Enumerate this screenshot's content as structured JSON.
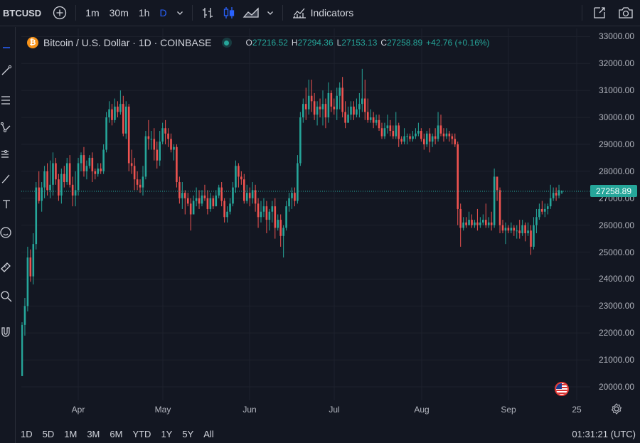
{
  "toolbar": {
    "symbol": "BTCUSD",
    "intervals": [
      "1m",
      "30m",
      "1h",
      "D"
    ],
    "active_interval": "D",
    "indicators_label": "Indicators"
  },
  "legend": {
    "title": "Bitcoin / U.S. Dollar · 1D · COINBASE",
    "open_label": "O",
    "open": "27216.52",
    "high_label": "H",
    "high": "27294.36",
    "low_label": "L",
    "low": "27153.13",
    "close_label": "C",
    "close": "27258.89",
    "change": "+42.76 (+0.16%)"
  },
  "price_axis": {
    "labels": [
      "33000.00",
      "32000.00",
      "31000.00",
      "30000.00",
      "29000.00",
      "28000.00",
      "27000.00",
      "26000.00",
      "25000.00",
      "24000.00",
      "23000.00",
      "22000.00",
      "21000.00",
      "20000.00"
    ],
    "current_price": "27258.89"
  },
  "time_axis": {
    "labels": [
      "Apr",
      "May",
      "Jun",
      "Jul",
      "Aug",
      "Sep",
      "25"
    ]
  },
  "bottom": {
    "ranges": [
      "1D",
      "5D",
      "1M",
      "3M",
      "6M",
      "YTD",
      "1Y",
      "5Y",
      "All"
    ],
    "clock": "01:31:21 (UTC)"
  },
  "colors": {
    "up": "#26a69a",
    "down": "#ef5350",
    "background": "#131722",
    "grid": "#1e222d"
  },
  "chart_data": {
    "type": "candlestick",
    "up_color": "#26a69a",
    "down_color": "#ef5350",
    "ylim": [
      19500,
      33300
    ],
    "candles": [
      [
        20400,
        22300,
        20400,
        22400
      ],
      [
        22300,
        23000,
        21900,
        23300
      ],
      [
        23000,
        24800,
        22800,
        25200
      ],
      [
        24800,
        24100,
        23900,
        25100
      ],
      [
        24100,
        25300,
        23800,
        25700
      ],
      [
        25300,
        27400,
        25100,
        27600
      ],
      [
        27400,
        26900,
        26800,
        28000
      ],
      [
        26900,
        27400,
        26500,
        27600
      ],
      [
        27400,
        28000,
        27000,
        28200
      ],
      [
        28000,
        27300,
        27100,
        28300
      ],
      [
        27300,
        27500,
        27000,
        28400
      ],
      [
        27500,
        28300,
        27100,
        28700
      ],
      [
        28300,
        27700,
        27500,
        28500
      ],
      [
        27700,
        27100,
        26900,
        27900
      ],
      [
        27100,
        27900,
        26800,
        28100
      ],
      [
        27900,
        27600,
        27400,
        28200
      ],
      [
        27600,
        28300,
        27500,
        28500
      ],
      [
        28300,
        27500,
        27400,
        28600
      ],
      [
        27500,
        27100,
        26700,
        27800
      ],
      [
        27100,
        27300,
        26700,
        28000
      ],
      [
        27300,
        28300,
        27100,
        28500
      ],
      [
        28300,
        28600,
        28000,
        28700
      ],
      [
        28600,
        28000,
        27800,
        28900
      ],
      [
        28000,
        28200,
        27700,
        28400
      ],
      [
        28200,
        28500,
        28100,
        28600
      ],
      [
        28500,
        28000,
        27600,
        28700
      ],
      [
        28000,
        27900,
        27700,
        28100
      ],
      [
        27900,
        28100,
        27800,
        28300
      ],
      [
        28100,
        28000,
        27900,
        28300
      ],
      [
        28000,
        28800,
        27900,
        29000
      ],
      [
        28800,
        30000,
        28700,
        30200
      ],
      [
        30000,
        30300,
        29800,
        30600
      ],
      [
        30300,
        29900,
        29700,
        30500
      ],
      [
        29900,
        30400,
        29800,
        30700
      ],
      [
        30400,
        30200,
        30000,
        30600
      ],
      [
        30200,
        30500,
        30100,
        31000
      ],
      [
        30500,
        29400,
        29300,
        30800
      ],
      [
        29400,
        30400,
        29200,
        30600
      ],
      [
        30400,
        28300,
        28000,
        30500
      ],
      [
        28300,
        28200,
        27900,
        28800
      ],
      [
        28200,
        27700,
        27300,
        28500
      ],
      [
        27700,
        27500,
        27300,
        28000
      ],
      [
        27500,
        27400,
        27200,
        27700
      ],
      [
        27400,
        27800,
        27100,
        28200
      ],
      [
        27800,
        29300,
        27700,
        29500
      ],
      [
        29300,
        29200,
        28800,
        29900
      ],
      [
        29200,
        29200,
        28800,
        29500
      ],
      [
        29200,
        28800,
        28400,
        29600
      ],
      [
        28800,
        28400,
        28100,
        29100
      ],
      [
        28400,
        29100,
        28200,
        29500
      ],
      [
        29100,
        29600,
        29000,
        29800
      ],
      [
        29600,
        29400,
        29000,
        29900
      ],
      [
        29400,
        29200,
        28900,
        29600
      ],
      [
        29200,
        28800,
        28700,
        29400
      ],
      [
        28800,
        28900,
        28400,
        29000
      ],
      [
        28900,
        27600,
        27400,
        29000
      ],
      [
        27600,
        27000,
        26800,
        27800
      ],
      [
        27000,
        27200,
        26600,
        27600
      ],
      [
        27200,
        27000,
        26400,
        27300
      ],
      [
        27000,
        26800,
        26700,
        27200
      ],
      [
        26800,
        26400,
        25800,
        27000
      ],
      [
        26400,
        26900,
        26400,
        27100
      ],
      [
        26900,
        27000,
        26700,
        27400
      ],
      [
        27000,
        26800,
        26600,
        27300
      ],
      [
        26800,
        27100,
        26700,
        27300
      ],
      [
        27100,
        27000,
        26900,
        27500
      ],
      [
        27000,
        26600,
        26400,
        27300
      ],
      [
        26600,
        27000,
        26500,
        27200
      ],
      [
        27000,
        26700,
        26600,
        27100
      ],
      [
        26700,
        27100,
        26700,
        27300
      ],
      [
        27100,
        27400,
        27000,
        27500
      ],
      [
        27400,
        26900,
        26700,
        27600
      ],
      [
        26900,
        26300,
        26100,
        27000
      ],
      [
        26300,
        26500,
        26100,
        26700
      ],
      [
        26500,
        26800,
        26400,
        27000
      ],
      [
        26800,
        27400,
        26700,
        27600
      ],
      [
        27400,
        28200,
        27200,
        28400
      ],
      [
        28200,
        27800,
        27400,
        28300
      ],
      [
        27800,
        27700,
        27500,
        28000
      ],
      [
        27700,
        26900,
        26800,
        27900
      ],
      [
        26900,
        27200,
        26800,
        27500
      ],
      [
        27200,
        27000,
        26700,
        27400
      ],
      [
        27000,
        27300,
        26800,
        27600
      ],
      [
        27300,
        26800,
        26500,
        27500
      ],
      [
        26800,
        26300,
        25900,
        27000
      ],
      [
        26300,
        26500,
        26100,
        26900
      ],
      [
        26500,
        26700,
        26300,
        27000
      ],
      [
        26700,
        26200,
        25700,
        26900
      ],
      [
        26200,
        26500,
        25800,
        26600
      ],
      [
        26500,
        26700,
        26100,
        26900
      ],
      [
        26700,
        25900,
        25500,
        27000
      ],
      [
        25900,
        26200,
        25800,
        26400
      ],
      [
        26200,
        25600,
        25200,
        26400
      ],
      [
        25600,
        25900,
        24800,
        26000
      ],
      [
        25900,
        26700,
        25800,
        26900
      ],
      [
        26700,
        27000,
        26500,
        27200
      ],
      [
        27000,
        27200,
        26600,
        27400
      ],
      [
        27200,
        26900,
        26700,
        27400
      ],
      [
        26900,
        28300,
        26800,
        28600
      ],
      [
        28300,
        30000,
        28200,
        30200
      ],
      [
        30000,
        30500,
        29800,
        30700
      ],
      [
        30500,
        30300,
        29900,
        31100
      ],
      [
        30300,
        30800,
        30100,
        31400
      ],
      [
        30800,
        30600,
        30200,
        31400
      ],
      [
        30600,
        30100,
        29900,
        30900
      ],
      [
        30100,
        30400,
        29700,
        30600
      ],
      [
        30400,
        30300,
        30000,
        30700
      ],
      [
        30300,
        30500,
        29700,
        31000
      ],
      [
        30500,
        30000,
        29600,
        30700
      ],
      [
        30000,
        30900,
        29800,
        31300
      ],
      [
        30900,
        30400,
        30200,
        31000
      ],
      [
        30400,
        30300,
        30100,
        30700
      ],
      [
        30300,
        30800,
        29900,
        31100
      ],
      [
        30800,
        31100,
        30300,
        31300
      ],
      [
        31100,
        30200,
        30000,
        31500
      ],
      [
        30200,
        29800,
        29600,
        30600
      ],
      [
        29800,
        30100,
        29800,
        30400
      ],
      [
        30100,
        30400,
        29900,
        30600
      ],
      [
        30400,
        30100,
        29900,
        30600
      ],
      [
        30100,
        30300,
        30000,
        30700
      ],
      [
        30300,
        30500,
        30000,
        30900
      ],
      [
        30500,
        30700,
        30200,
        31800
      ],
      [
        30700,
        30200,
        29900,
        31400
      ],
      [
        30200,
        29900,
        29800,
        30700
      ],
      [
        29900,
        30000,
        29800,
        30300
      ],
      [
        30000,
        29800,
        29600,
        30200
      ],
      [
        29800,
        29900,
        29700,
        30100
      ],
      [
        29900,
        29600,
        29500,
        30100
      ],
      [
        29600,
        29300,
        29200,
        29800
      ],
      [
        29300,
        29600,
        29200,
        29800
      ],
      [
        29600,
        29700,
        29400,
        30100
      ],
      [
        29700,
        29500,
        29300,
        29900
      ],
      [
        29500,
        29300,
        29200,
        29700
      ],
      [
        29300,
        29700,
        29200,
        30200
      ],
      [
        29700,
        29200,
        28900,
        29800
      ],
      [
        29200,
        29100,
        29000,
        29300
      ],
      [
        29100,
        29300,
        29000,
        29600
      ],
      [
        29300,
        29300,
        29000,
        29400
      ],
      [
        29300,
        29200,
        29100,
        29400
      ],
      [
        29200,
        29300,
        29100,
        29500
      ],
      [
        29300,
        29400,
        29200,
        29600
      ],
      [
        29400,
        29500,
        29300,
        29800
      ],
      [
        29500,
        29200,
        29100,
        29600
      ],
      [
        29200,
        29000,
        28800,
        29400
      ],
      [
        29000,
        29400,
        28900,
        29500
      ],
      [
        29400,
        29100,
        28700,
        29600
      ],
      [
        29100,
        29300,
        28900,
        29400
      ],
      [
        29300,
        29200,
        29000,
        29600
      ],
      [
        29200,
        29700,
        29100,
        30200
      ],
      [
        29700,
        29400,
        29300,
        30100
      ],
      [
        29400,
        29300,
        29100,
        29600
      ],
      [
        29300,
        29400,
        29200,
        29600
      ],
      [
        29400,
        29300,
        29100,
        29500
      ],
      [
        29300,
        29200,
        29000,
        29400
      ],
      [
        29200,
        29000,
        28900,
        29400
      ],
      [
        29000,
        26600,
        26000,
        29100
      ],
      [
        26600,
        25900,
        25200,
        26800
      ],
      [
        25900,
        26100,
        25800,
        26300
      ],
      [
        26100,
        26000,
        25900,
        26300
      ],
      [
        26000,
        26200,
        26000,
        26500
      ],
      [
        26200,
        26000,
        25900,
        26400
      ],
      [
        26000,
        26100,
        25900,
        26200
      ],
      [
        26100,
        26000,
        25800,
        26600
      ],
      [
        26000,
        26100,
        25900,
        26300
      ],
      [
        26100,
        26200,
        26000,
        26400
      ],
      [
        26200,
        26000,
        25900,
        26800
      ],
      [
        26000,
        26100,
        25900,
        26300
      ],
      [
        26100,
        26000,
        25800,
        26500
      ],
      [
        26000,
        27800,
        25900,
        28100
      ],
      [
        27800,
        27300,
        26900,
        27600
      ],
      [
        27300,
        26000,
        25700,
        27400
      ],
      [
        26000,
        25800,
        25700,
        26200
      ],
      [
        25800,
        25900,
        25300,
        26100
      ],
      [
        25900,
        25800,
        25700,
        26000
      ],
      [
        25800,
        25900,
        25700,
        26100
      ],
      [
        25900,
        25800,
        25600,
        26000
      ],
      [
        25800,
        25800,
        25500,
        26000
      ],
      [
        25800,
        25700,
        25500,
        26200
      ],
      [
        25700,
        26000,
        25600,
        26200
      ],
      [
        26000,
        25700,
        25400,
        26100
      ],
      [
        25700,
        25800,
        25600,
        26100
      ],
      [
        25800,
        25200,
        24900,
        26000
      ],
      [
        25200,
        26000,
        25100,
        26300
      ],
      [
        26000,
        26300,
        25700,
        26600
      ],
      [
        26300,
        26600,
        26200,
        26800
      ],
      [
        26600,
        26500,
        26400,
        26900
      ],
      [
        26500,
        26600,
        26300,
        26800
      ],
      [
        26600,
        26700,
        26400,
        26800
      ],
      [
        26700,
        27000,
        26600,
        27500
      ],
      [
        27000,
        27200,
        26900,
        27400
      ],
      [
        27200,
        27100,
        26900,
        27400
      ],
      [
        27100,
        27300,
        27000,
        27500
      ],
      [
        27216,
        27259,
        27153,
        27294
      ]
    ]
  }
}
